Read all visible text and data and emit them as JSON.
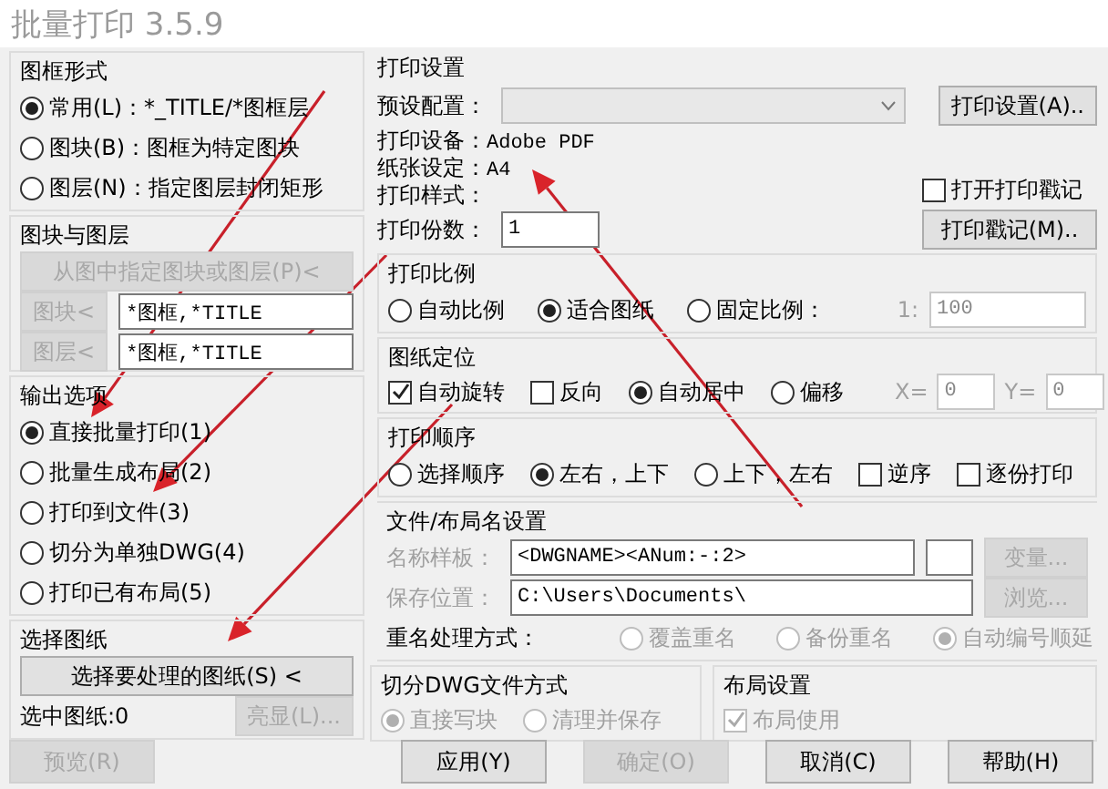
{
  "window": {
    "title": "批量打印 3.5.9"
  },
  "left": {
    "frame_style": {
      "title": "图框形式",
      "options": [
        {
          "label": "常用(L)：*_TITLE/*图框层",
          "selected": true
        },
        {
          "label": "图块(B)：图框为特定图块",
          "selected": false
        },
        {
          "label": "图层(N)：指定图层封闭矩形",
          "selected": false
        }
      ]
    },
    "block_layer": {
      "title": "图块与图层",
      "pick_button": {
        "label": "从图中指定图块或图层(P)<",
        "disabled": true
      },
      "rows": [
        {
          "button": {
            "label": "图块<",
            "disabled": true
          },
          "value": "*图框,*TITLE"
        },
        {
          "button": {
            "label": "图层<",
            "disabled": true
          },
          "value": "*图框,*TITLE"
        }
      ]
    },
    "output_options": {
      "title": "输出选项",
      "options": [
        {
          "label": "直接批量打印(1)",
          "selected": true
        },
        {
          "label": "批量生成布局(2)",
          "selected": false
        },
        {
          "label": "打印到文件(3)",
          "selected": false
        },
        {
          "label": "切分为单独DWG(4)",
          "selected": false
        },
        {
          "label": "打印已有布局(5)",
          "selected": false
        }
      ]
    },
    "select_drawings": {
      "title": "选择图纸",
      "select_button": {
        "label": "选择要处理的图纸(S) <",
        "disabled": false
      },
      "selected_count": "选中图纸:0",
      "highlight_button": {
        "label": "亮显(L)...",
        "disabled": true
      }
    }
  },
  "right": {
    "print_settings": {
      "title": "打印设置",
      "preset_label": "预设配置：",
      "setup_button": {
        "label": "打印设置(A)..",
        "disabled": false
      },
      "device": {
        "label": "打印设备：",
        "value": "Adobe PDF"
      },
      "paper": {
        "label": "纸张设定：",
        "value": "A4"
      },
      "style": {
        "label": "打印样式："
      },
      "copies": {
        "label": "打印份数：",
        "value": "1"
      },
      "stamp_checkbox": {
        "label": "打开打印戳记",
        "checked": false
      },
      "stamp_button": {
        "label": "打印戳记(M)..",
        "disabled": false
      }
    },
    "scale": {
      "title": "打印比例",
      "options": [
        {
          "label": "自动比例",
          "selected": false
        },
        {
          "label": "适合图纸",
          "selected": true
        },
        {
          "label": "固定比例：",
          "selected": false
        }
      ],
      "ratio_label": "1:",
      "ratio_value": "100",
      "ratio_disabled": true
    },
    "position": {
      "title": "图纸定位",
      "items": [
        {
          "kind": "checkbox",
          "label": "自动旋转",
          "checked": true
        },
        {
          "kind": "checkbox",
          "label": "反向",
          "checked": false
        },
        {
          "kind": "radio",
          "label": "自动居中",
          "selected": true
        },
        {
          "kind": "radio",
          "label": "偏移",
          "selected": false
        }
      ],
      "x_label": "X=",
      "x_value": "0",
      "y_label": "Y=",
      "y_value": "0",
      "offset_disabled": true
    },
    "order": {
      "title": "打印顺序",
      "items": [
        {
          "kind": "radio",
          "label": "选择顺序",
          "selected": false
        },
        {
          "kind": "radio",
          "label": "左右，上下",
          "selected": true
        },
        {
          "kind": "radio",
          "label": "上下，左右",
          "selected": false
        },
        {
          "kind": "checkbox",
          "label": "逆序",
          "checked": false
        },
        {
          "kind": "checkbox",
          "label": "逐份打印",
          "checked": false
        }
      ]
    },
    "file_names": {
      "title": "文件/布局名设置",
      "disabled": true,
      "name_template": {
        "label": "名称样板：",
        "value": "<DWGNAME><ANum:-:2>"
      },
      "variable_button": {
        "label": "变量...",
        "disabled": true
      },
      "save_location": {
        "label": "保存位置：",
        "value": "C:\\Users\\Documents\\"
      },
      "browse_button": {
        "label": "浏览...",
        "disabled": true
      },
      "rename_label": "重名处理方式：",
      "rename_options": [
        {
          "label": "覆盖重名",
          "selected": false
        },
        {
          "label": "备份重名",
          "selected": false
        },
        {
          "label": "自动编号顺延",
          "selected": true
        }
      ]
    },
    "split": {
      "title": "切分DWG文件方式",
      "disabled": true,
      "options": [
        {
          "label": "直接写块",
          "selected": true
        },
        {
          "label": "清理并保存",
          "selected": false
        }
      ]
    },
    "layout": {
      "title": "布局设置",
      "checkbox": {
        "label": "布局使用",
        "checked": true,
        "disabled": true
      }
    }
  },
  "buttons": [
    {
      "label": "预览(R)",
      "disabled": true
    },
    {
      "label": "应用(Y)",
      "disabled": false
    },
    {
      "label": "确定(O)",
      "disabled": true
    },
    {
      "label": "取消(C)",
      "disabled": false
    },
    {
      "label": "帮助(H)",
      "disabled": false
    }
  ]
}
